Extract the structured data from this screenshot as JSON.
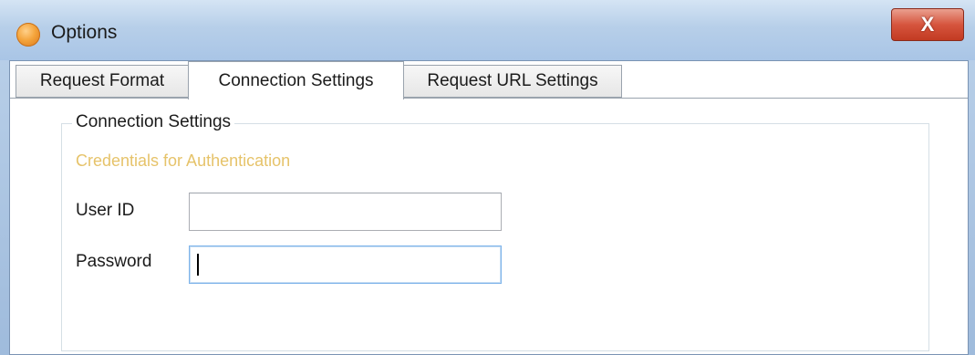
{
  "window": {
    "title": "Options",
    "close_label": "X"
  },
  "tabs": [
    {
      "label": "Request Format"
    },
    {
      "label": "Connection Settings"
    },
    {
      "label": "Request URL Settings"
    }
  ],
  "connection": {
    "group_title": "Connection Settings",
    "credentials_caption": "Credentials for Authentication",
    "user_id_label": "User ID",
    "user_id_value": "",
    "password_label": "Password",
    "password_value": ""
  }
}
